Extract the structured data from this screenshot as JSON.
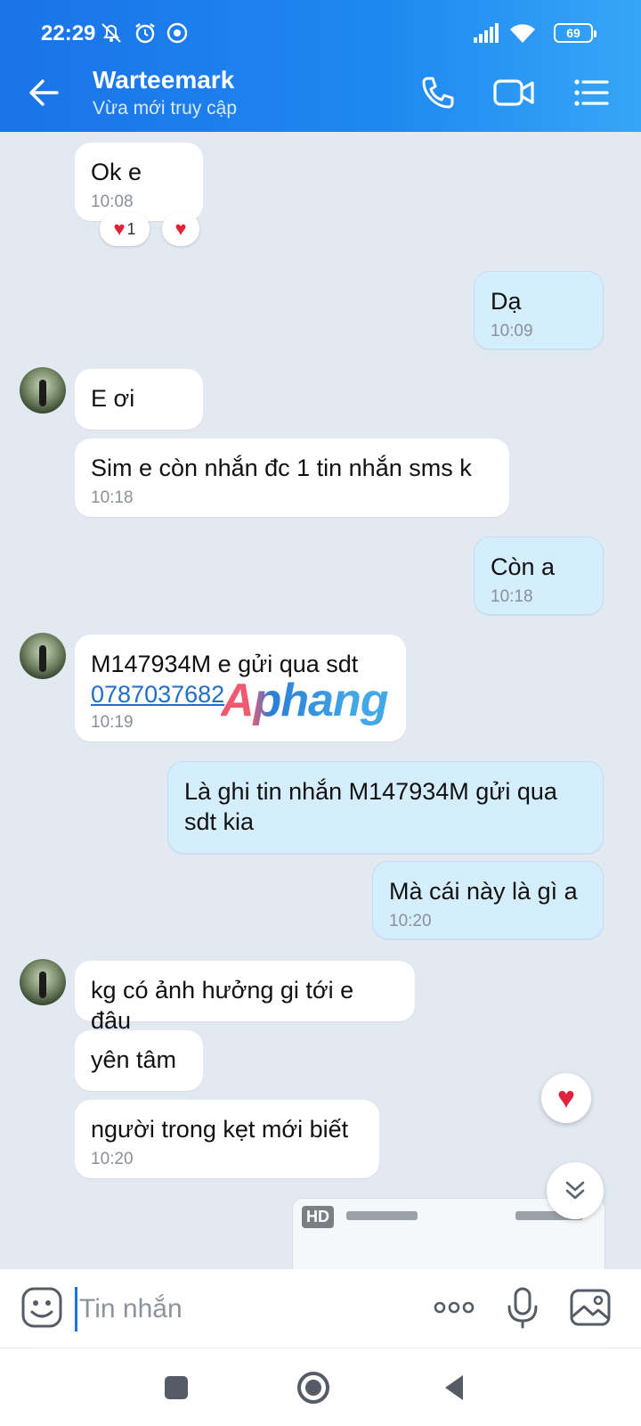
{
  "status_bar": {
    "time": "22:29",
    "battery": "69"
  },
  "header": {
    "contact_name": "Warteemark",
    "contact_status": "Vừa mới truy cập"
  },
  "messages": [
    {
      "dir": "in",
      "text": "Ok e",
      "time": "10:08"
    },
    {
      "dir": "out",
      "text": "Dạ",
      "time": "10:09"
    },
    {
      "dir": "in",
      "text": "E ơi"
    },
    {
      "dir": "in",
      "text": "Sim e còn nhắn đc 1 tin nhắn sms k",
      "time": "10:18"
    },
    {
      "dir": "out",
      "text": "Còn a",
      "time": "10:18"
    },
    {
      "dir": "in",
      "text": "M147934M  e gửi qua sdt",
      "link": "0787037682",
      "time": "10:19"
    },
    {
      "dir": "out",
      "text": "Là ghi tin nhắn M147934M gửi qua",
      "text2": "sdt kia"
    },
    {
      "dir": "out",
      "text": "Mà cái này là gì a",
      "time": "10:20"
    },
    {
      "dir": "in",
      "text": "kg có ảnh hưởng gi tới e đâu"
    },
    {
      "dir": "in",
      "text": "yên tâm"
    },
    {
      "dir": "in",
      "text": "người trong kẹt mới biết",
      "time": "10:20"
    }
  ],
  "reactions": {
    "first_count": "1"
  },
  "watermark": "Aphang",
  "attachment": {
    "badge": "HD"
  },
  "input": {
    "placeholder": "Tin nhắn"
  },
  "icons": {
    "back": "arrow-left-icon",
    "call": "phone-icon",
    "video": "video-camera-icon",
    "menu": "list-menu-icon",
    "sticker": "sticker-smile-icon",
    "more": "more-dots-icon",
    "mic": "microphone-icon",
    "image": "image-gallery-icon"
  },
  "colors": {
    "header_start": "#1a73e8",
    "header_end": "#36a6f7",
    "outgoing_bubble": "#d5eefd",
    "incoming_bubble": "#ffffff",
    "chat_background": "#e2e9f1",
    "heart": "#e0233a",
    "link": "#1f6fc9"
  }
}
